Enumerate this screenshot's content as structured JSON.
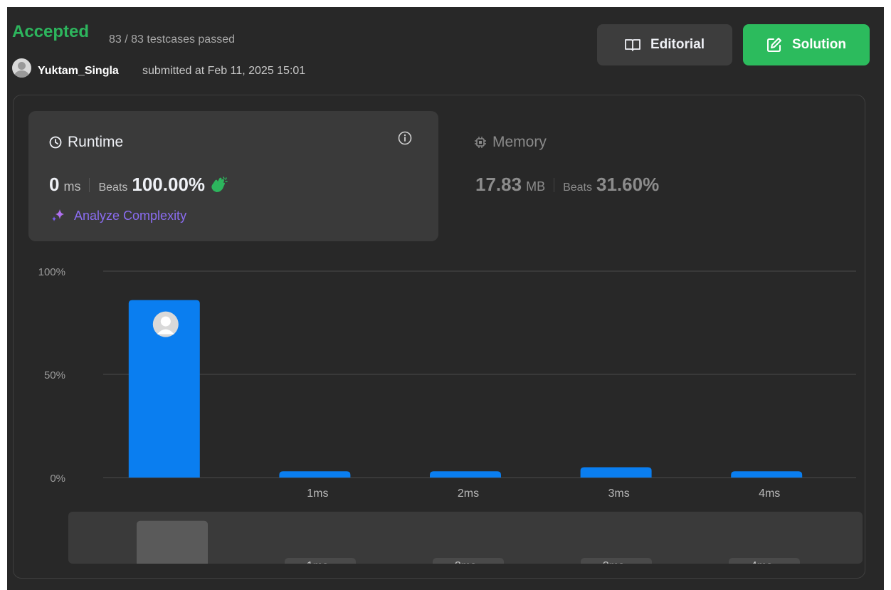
{
  "status": {
    "title": "Accepted",
    "testcases": "83 / 83 testcases passed",
    "username": "Yuktam_Singla",
    "submitted": "submitted at Feb 11, 2025 15:01"
  },
  "buttons": {
    "editorial": "Editorial",
    "solution": "Solution"
  },
  "runtime": {
    "title": "Runtime",
    "value": "0",
    "unit": "ms",
    "beats_label": "Beats",
    "beats": "100.00%",
    "analyze": "Analyze Complexity"
  },
  "memory": {
    "title": "Memory",
    "value": "17.83",
    "unit": "MB",
    "beats_label": "Beats",
    "beats": "31.60%"
  },
  "colors": {
    "accepted": "#2db55d",
    "solution_button": "#2cbb5d",
    "bar": "#0a7ef0",
    "analyze": "#8a6cf0"
  },
  "chart_data": {
    "type": "bar",
    "categories": [
      "0ms",
      "1ms",
      "2ms",
      "3ms",
      "4ms"
    ],
    "tick_labels": [
      "",
      "1ms",
      "2ms",
      "3ms",
      "4ms"
    ],
    "values": [
      86,
      3,
      3,
      5,
      3
    ],
    "y_tick_labels": [
      "100%",
      "50%",
      "0%"
    ],
    "ylim": [
      0,
      100
    ],
    "grid": true,
    "highlighted_category": "0ms"
  }
}
